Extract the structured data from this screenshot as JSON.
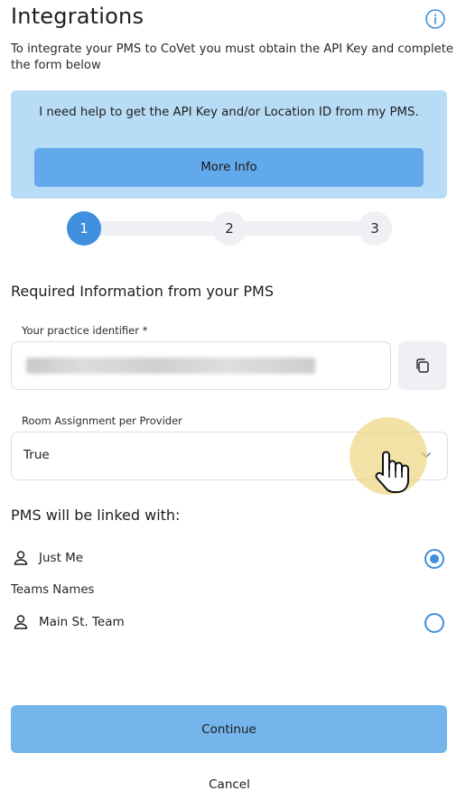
{
  "header": {
    "title": "Integrations",
    "subtitle": "To integrate your PMS to CoVet you must obtain the API Key and complete the form below",
    "info_icon": "info-circle-icon"
  },
  "help_card": {
    "text": "I need help to get the API Key and/or Location ID from my PMS.",
    "button_label": "More Info"
  },
  "stepper": {
    "steps": [
      "1",
      "2",
      "3"
    ],
    "active_step": 1
  },
  "required_section": {
    "title": "Required Information from your PMS",
    "identifier_label": "Your practice identifier *",
    "identifier_value_redacted": true,
    "copy_icon": "copy-icon",
    "room_label": "Room Assignment per Provider",
    "room_value": "True"
  },
  "linked_section": {
    "title": "PMS will be linked with:",
    "just_me_label": "Just Me",
    "just_me_selected": true,
    "teams_heading": "Teams Names",
    "teams": [
      {
        "label": "Main St. Team",
        "selected": false
      }
    ]
  },
  "actions": {
    "continue_label": "Continue",
    "cancel_label": "Cancel"
  },
  "colors": {
    "accent": "#3f8fde",
    "card_bg": "#b9dcf6",
    "more_info_bg": "#62a9eb",
    "continue_bg": "#74b6ec",
    "cursor_halo": "#ecd070"
  }
}
